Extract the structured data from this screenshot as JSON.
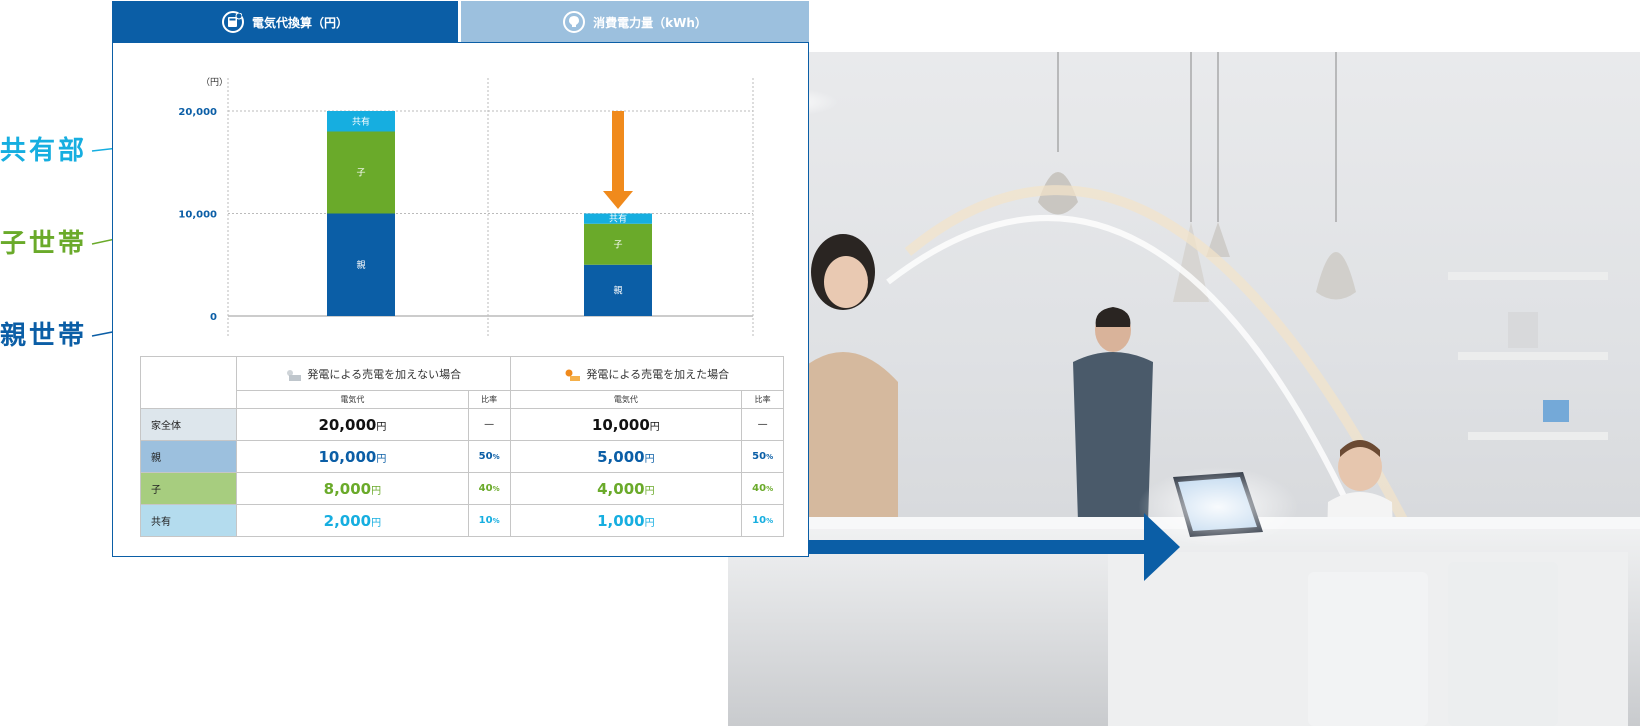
{
  "tabs": [
    {
      "label": "電気代換算（円）",
      "icon": "calculator-icon",
      "active": true
    },
    {
      "label": "消費電力量（kWh）",
      "icon": "lightbulb-icon",
      "active": false
    }
  ],
  "side_labels": [
    {
      "text": "共有部",
      "color": "#16aee0"
    },
    {
      "text": "子世帯",
      "color": "#6aaa2a"
    },
    {
      "text": "親世帯",
      "color": "#0b5ea6"
    }
  ],
  "chart_data": {
    "type": "bar",
    "stacked": true,
    "unit": "（円）",
    "y_ticks": [
      "20,000",
      "10,000",
      "0"
    ],
    "ylim": [
      0,
      20000
    ],
    "grid": true,
    "categories": [
      "発電による売電を加えない場合",
      "発電による売電を加えた場合"
    ],
    "series": [
      {
        "name": "親",
        "color": "#0b5ea6",
        "values": [
          10000,
          5000
        ]
      },
      {
        "name": "子",
        "color": "#6aaa2a",
        "values": [
          8000,
          4000
        ]
      },
      {
        "name": "共有",
        "color": "#16aee0",
        "values": [
          2000,
          1000
        ]
      }
    ],
    "annotation": "arrow-down",
    "annotation_color": "#f08a1c"
  },
  "table": {
    "col_headers": [
      "発電による売電を加えない場合",
      "発電による売電を加えた場合"
    ],
    "sub_headers": [
      "電気代",
      "比率",
      "電気代",
      "比率"
    ],
    "yen": "円",
    "pct_unit": "%",
    "rows": [
      {
        "label": "家全体",
        "bg": "#dde6ec",
        "color": "#111111",
        "v1": "20,000",
        "p1": "—",
        "v2": "10,000",
        "p2": "—"
      },
      {
        "label": "親",
        "bg": "#9cc0de",
        "color": "#0b5ea6",
        "v1": "10,000",
        "p1": "50",
        "v2": "5,000",
        "p2": "50"
      },
      {
        "label": "子",
        "bg": "#a7cd7f",
        "color": "#6aaa2a",
        "v1": "8,000",
        "p1": "40",
        "v2": "4,000",
        "p2": "40"
      },
      {
        "label": "共有",
        "bg": "#b4dcee",
        "color": "#16aee0",
        "v1": "2,000",
        "p1": "10",
        "v2": "1,000",
        "p2": "10"
      }
    ]
  },
  "flow_arrow_color": "#0b5ea6"
}
